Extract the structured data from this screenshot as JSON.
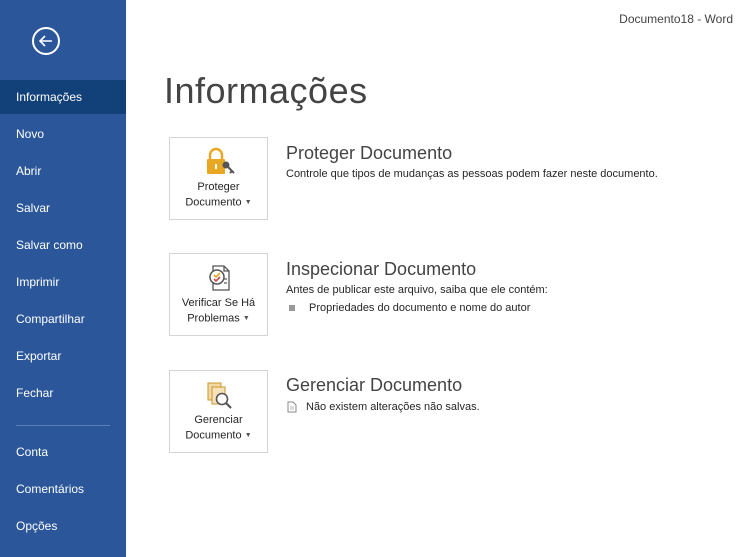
{
  "window": {
    "title": "Documento18 - Word"
  },
  "sidebar": {
    "items": [
      {
        "label": "Informações",
        "active": true
      },
      {
        "label": "Novo"
      },
      {
        "label": "Abrir"
      },
      {
        "label": "Salvar"
      },
      {
        "label": "Salvar como"
      },
      {
        "label": "Imprimir"
      },
      {
        "label": "Compartilhar"
      },
      {
        "label": "Exportar"
      },
      {
        "label": "Fechar"
      },
      {
        "label": "Conta"
      },
      {
        "label": "Comentários"
      },
      {
        "label": "Opções"
      }
    ]
  },
  "main": {
    "title": "Informações",
    "sections": [
      {
        "tile_label_1": "Proteger",
        "tile_label_2": "Documento",
        "title": "Proteger Documento",
        "description": "Controle que tipos de mudanças as pessoas podem fazer neste documento."
      },
      {
        "tile_label_1": "Verificar Se Há",
        "tile_label_2": "Problemas",
        "title": "Inspecionar Documento",
        "description": "Antes de publicar este arquivo, saiba que ele contém:",
        "bullet": "Propriedades do documento e nome do autor"
      },
      {
        "tile_label_1": "Gerenciar",
        "tile_label_2": "Documento",
        "title": "Gerenciar Documento",
        "note": "Não existem alterações não salvas."
      }
    ]
  },
  "colors": {
    "sidebar_bg": "#2b579a",
    "sidebar_active": "#124078",
    "lock_gold": "#e8a823"
  }
}
